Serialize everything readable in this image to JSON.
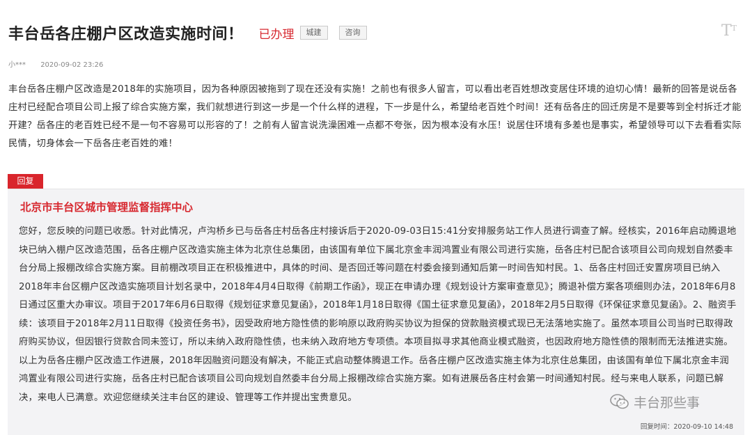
{
  "header": {
    "title": "丰台岳各庄棚户区改造实施时间！",
    "status": "已办理",
    "tags": [
      "城建",
      "咨询"
    ],
    "font_toggle": "T"
  },
  "meta": {
    "user": "小***",
    "datetime": "2020-09-02 23:26"
  },
  "content": "丰台岳各庄棚户区改造是2018年的实施项目，因为各种原因被拖到了现在还没有实施！之前也有很多人留言，可以看出老百姓想改变居住环境的迫切心情！最新的回答是说岳各庄村已经配合项目公司上报了综合实施方案，我们就想进行到这一步是一个什么样的进程，下一步是什么，希望给老百姓个时间！还有岳各庄的回迁房是不是要等到全村拆迁才能开建？岳各庄的老百姓已经不是一句不容易可以形容的了！之前有人留言说洗澡困难一点都不夸张，因为根本没有水压！说居住环境有多差也是事实，希望领导可以下去看看实际民情，切身体会一下岳各庄老百姓的难！",
  "reply": {
    "tab_label": "回复",
    "org": "北京市丰台区城市管理监督指挥中心",
    "text": "您好，您反映的问题已收悉。针对此情况，卢沟桥乡已与岳各庄村岳各庄村接诉后于2020-09-03日15:41分安排服务站工作人员进行调查了解。经核实，2016年启动腾退地块已纳入棚户区改造范围，岳各庄棚户区改造实施主体为北京住总集团，由该国有单位下属北京金丰润鸿置业有限公司进行实施，岳各庄村已配合该项目公司向规划自然委丰台分局上报棚改综合实施方案。目前棚改项目正在积极推进中，具体的时间、是否回迁等问题在村委会接到通知后第一时间告知村民。1、岳各庄村回迁安置房项目已纳入2018年丰台区棚户区改造实施项目计划名录中，2018年4月4日取得《前期工作函》，现正在申请办理《规划设计方案审查意见》；腾退补偿方案各项细则办法，2018年6月8日通过区重大办审议。项目于2017年6月6日取得《规划征求意见复函》，2018年1月18日取得《国土征求意见复函》，2018年2月5日取得《环保征求意见复函》。2、融资手续：该项目于2018年2月11日取得《投资任务书》，因受政府地方隐性债的影响原以政府购买协议为担保的贷款融资模式现已无法落地实施了。虽然本项目公司当时已取得政府购买协议，但因银行贷款合同未签订，所以未纳入政府隐性债，也未纳入政府地方专项债。本项目拟寻求其他商业模式融资，也因政府地方隐性债的限制而无法推进实施。以上为岳各庄棚户区改造工作进展，2018年因融资问题没有解决，不能正式启动整体腾退工作。岳各庄棚户区改造实施主体为北京住总集团，由该国有单位下属北京金丰润鸿置业有限公司进行实施，岳各庄村已配合该项目公司向规划自然委丰台分局上报棚改综合实施方案。如有进展岳各庄村会第一时间通知村民。经与来电人联系，问题已解决，来电人已满意。欢迎您继续关注丰台区的建设、管理等工作并提出宝贵意见。",
    "time": "回复时间：2020-09-10 14:48"
  },
  "watermark": "丰台那些事",
  "colors": {
    "accent_red": "#d7282f",
    "reply_bg": "#f3f3f5",
    "text": "#333333"
  }
}
